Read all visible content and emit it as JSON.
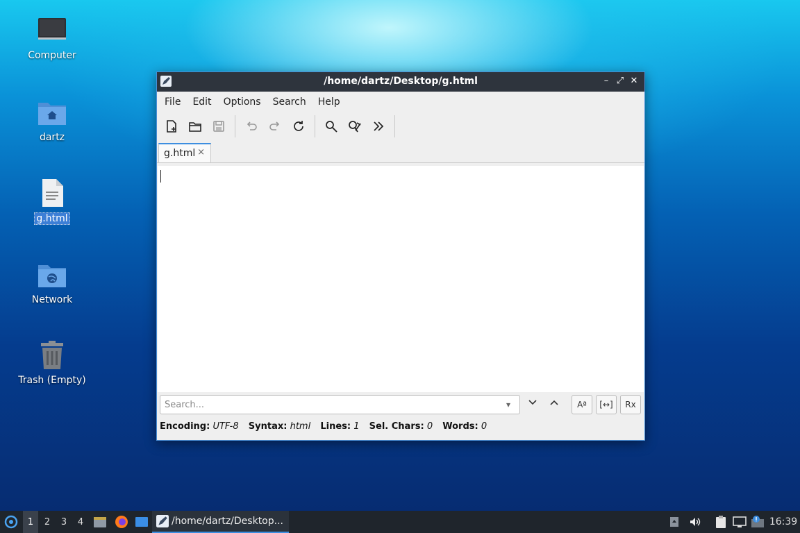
{
  "desktop": {
    "icons": [
      {
        "label": "Computer"
      },
      {
        "label": "dartz"
      },
      {
        "label": "g.html"
      },
      {
        "label": "Network"
      },
      {
        "label": "Trash (Empty)"
      }
    ]
  },
  "window": {
    "title": "/home/dartz/Desktop/g.html",
    "controls": {
      "minimize": "–",
      "maximize": "⤢",
      "close": "✕"
    },
    "menu": [
      "File",
      "Edit",
      "Options",
      "Search",
      "Help"
    ],
    "toolbar": [
      "new-file",
      "open-file",
      "save-file",
      "undo",
      "redo",
      "reload",
      "find",
      "replace",
      "more"
    ],
    "tab": {
      "label": "g.html",
      "close": "×"
    },
    "search": {
      "placeholder": "Search..."
    },
    "find_options": {
      "match_case": "Aª",
      "whole_word": "[↔]",
      "regex": "Rx"
    },
    "status": {
      "encoding_label": "Encoding:",
      "encoding": "UTF-8",
      "syntax_label": "Syntax:",
      "syntax": "html",
      "lines_label": "Lines:",
      "lines": "1",
      "sel_label": "Sel. Chars:",
      "sel": "0",
      "words_label": "Words:",
      "words": "0"
    }
  },
  "taskbar": {
    "workspaces": [
      "1",
      "2",
      "3",
      "4"
    ],
    "active_workspace": "1",
    "task_title": "/home/dartz/Desktop...",
    "clock": "16:39"
  },
  "colors": {
    "accent": "#3d8ee0",
    "titlebar": "#2e343d",
    "taskbar": "#1f252c"
  }
}
